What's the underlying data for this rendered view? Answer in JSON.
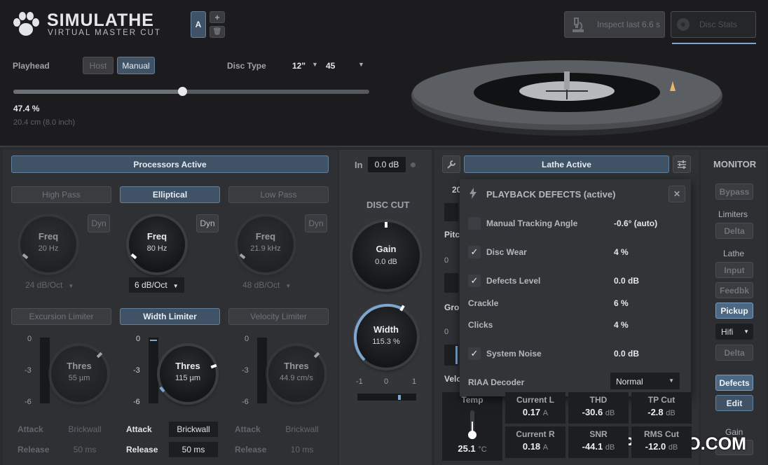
{
  "header": {
    "app_title": "SIMULATHE",
    "app_subtitle": "VIRTUAL MASTER CUT",
    "preset_slot": "A",
    "add_glyph": "+",
    "delete_glyph": "🗑",
    "inspect_label": "Inspect last 6.6 s",
    "disc_stats_label": "Disc Stats"
  },
  "playhead": {
    "label": "Playhead",
    "host_label": "Host",
    "manual_label": "Manual",
    "percent": "47.4 %",
    "position_text": "20.4 cm (8.0 inch)",
    "value_fraction": 0.474
  },
  "disc_type": {
    "label": "Disc Type",
    "size": "12\"",
    "speed": "45"
  },
  "processors": {
    "active_label": "Processors Active",
    "filters": [
      {
        "tab": "High Pass",
        "knob_label": "Freq",
        "knob_value": "20 Hz",
        "slope": "24 dB/Oct",
        "dyn": "Dyn",
        "active": false
      },
      {
        "tab": "Elliptical",
        "knob_label": "Freq",
        "knob_value": "80 Hz",
        "slope": "6 dB/Oct",
        "dyn": "Dyn",
        "active": true
      },
      {
        "tab": "Low Pass",
        "knob_label": "Freq",
        "knob_value": "21.9 kHz",
        "slope": "48 dB/Oct",
        "dyn": "Dyn",
        "active": false
      }
    ],
    "limiters": [
      {
        "tab": "Excursion Limiter",
        "knob_label": "Thres",
        "knob_value": "55 µm",
        "attack_label": "Attack",
        "attack": "Brickwall",
        "release_label": "Release",
        "release": "50 ms",
        "active": false
      },
      {
        "tab": "Width Limiter",
        "knob_label": "Thres",
        "knob_value": "115 µm",
        "attack_label": "Attack",
        "attack": "Brickwall",
        "release_label": "Release",
        "release": "50 ms",
        "active": true
      },
      {
        "tab": "Velocity Limiter",
        "knob_label": "Thres",
        "knob_value": "44.9 cm/s",
        "attack_label": "Attack",
        "attack": "Brickwall",
        "release_label": "Release",
        "release": "10 ms",
        "active": false
      }
    ],
    "meter_ticks": [
      "0",
      "-3",
      "-6"
    ]
  },
  "disc_cut": {
    "in_label": "In",
    "in_value": "0.0 dB",
    "title": "DISC CUT",
    "gain_label": "Gain",
    "gain_value": "0.0 dB",
    "width_label": "Width",
    "width_value": "115.3 %",
    "balance_ticks": [
      "-1",
      "0",
      "1"
    ]
  },
  "lathe": {
    "active_label": "Lathe Active",
    "left_labels": [
      "20",
      "Pitc",
      "0",
      "Gro",
      "0",
      "Velo"
    ]
  },
  "defects_popup": {
    "title": "PLAYBACK DEFECTS (active)",
    "close_glyph": "✕",
    "rows": [
      {
        "label": "Manual Tracking Angle",
        "value": "-0.6° (auto)",
        "checked": false
      },
      {
        "label": "Disc Wear",
        "value": "4 %",
        "checked": true
      },
      {
        "label": "Defects Level",
        "value": "0.0 dB",
        "checked": true
      },
      {
        "label": "Crackle",
        "value": "6 %",
        "checked": null
      },
      {
        "label": "Clicks",
        "value": "4 %",
        "checked": null
      },
      {
        "label": "System Noise",
        "value": "0.0 dB",
        "checked": true
      }
    ],
    "riaa_label": "RIAA Decoder",
    "riaa_value": "Normal"
  },
  "stats": {
    "temp_label": "Temp",
    "temp_value": "25.1",
    "temp_unit": "°C",
    "cells": [
      {
        "label": "Current L",
        "value": "0.17",
        "unit": "A"
      },
      {
        "label": "THD",
        "value": "-30.6",
        "unit": "dB"
      },
      {
        "label": "TP Cut",
        "value": "-2.8",
        "unit": "dB"
      },
      {
        "label": "Current R",
        "value": "0.18",
        "unit": "A"
      },
      {
        "label": "SNR",
        "value": "-44.1",
        "unit": "dB"
      },
      {
        "label": "RMS Cut",
        "value": "-12.0",
        "unit": "dB"
      }
    ]
  },
  "monitor": {
    "title": "MONITOR",
    "bypass": "Bypass",
    "limiters_label": "Limiters",
    "delta1": "Delta",
    "lathe_label": "Lathe",
    "input": "Input",
    "feedbk": "Feedbk",
    "pickup": "Pickup",
    "hifi": "Hifi",
    "delta2": "Delta",
    "defects": "Defects",
    "edit": "Edit",
    "gain_label": "Gain"
  },
  "watermark": "LSYPSTUDIO.COM",
  "colors": {
    "accent": "#7fa6cf",
    "active_button": "#3f5266",
    "background": "#1c1c1e"
  }
}
